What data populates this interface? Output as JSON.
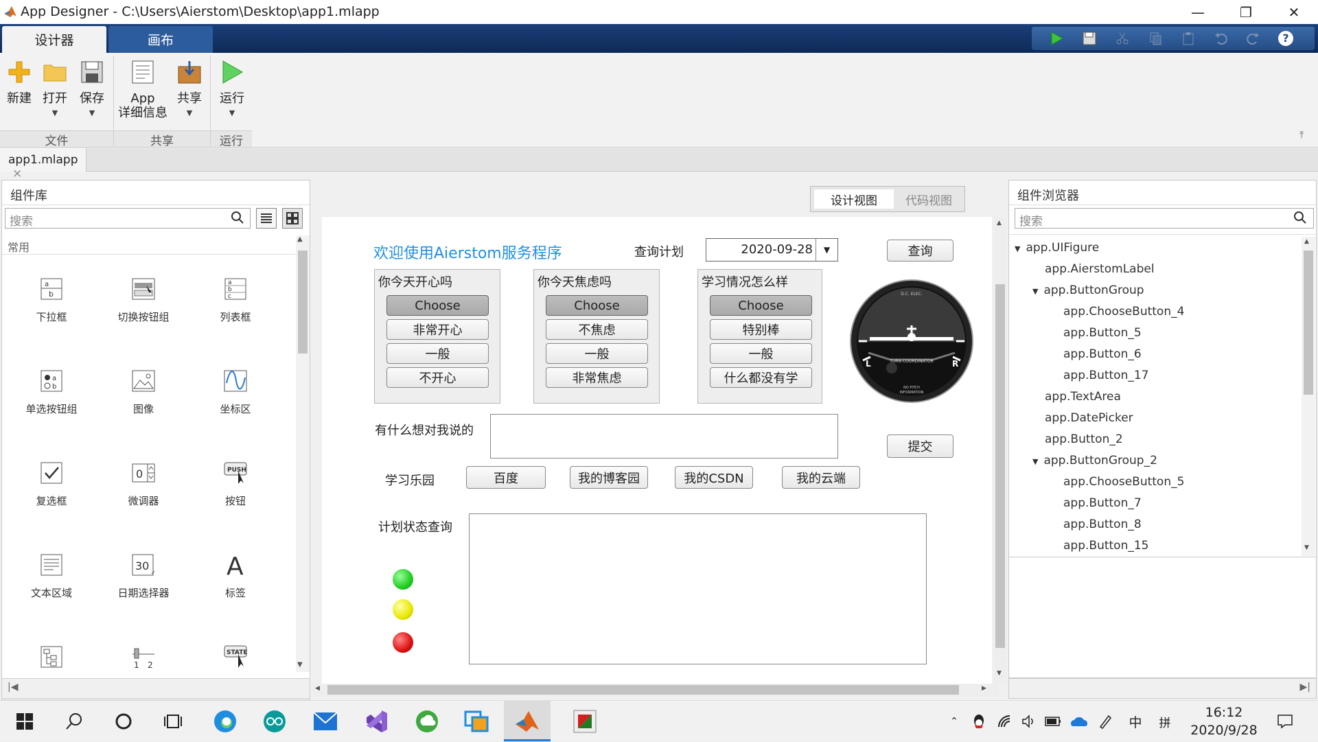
{
  "window": {
    "title": "App Designer - C:\\Users\\Aierstom\\Desktop\\app1.mlapp",
    "minimize": "—",
    "restore": "❐",
    "close": "✕"
  },
  "ribbon_tabs": [
    "设计器",
    "画布"
  ],
  "ribbon": {
    "new": "新建",
    "open": "打开",
    "save": "保存",
    "app_details_line1": "App",
    "app_details_line2": "详细信息",
    "share": "共享",
    "run": "运行",
    "group_file": "文件",
    "group_share": "共享",
    "group_run": "运行"
  },
  "doc_tab": {
    "name": "app1.mlapp",
    "close": "×"
  },
  "library": {
    "title": "组件库",
    "search_placeholder": "搜索",
    "section": "常用",
    "items": [
      "下拉框",
      "切换按钮组",
      "列表框",
      "单选按钮组",
      "图像",
      "坐标区",
      "复选框",
      "微调器",
      "按钮",
      "文本区域",
      "日期选择器",
      "标签"
    ]
  },
  "view_toggle": {
    "design": "设计视图",
    "code": "代码视图"
  },
  "app": {
    "welcome": "欢迎使用Aierstom服务程序",
    "query_plan_label": "查询计划",
    "date_value": "2020-09-28",
    "query_button": "查询",
    "group1": {
      "title": "你今天开心吗",
      "buttons": [
        "Choose",
        "非常开心",
        "一般",
        "不开心"
      ]
    },
    "group2": {
      "title": "你今天焦虑吗",
      "buttons": [
        "Choose",
        "不焦虑",
        "一般",
        "非常焦虑"
      ]
    },
    "group3": {
      "title": "学习情况怎么样",
      "buttons": [
        "Choose",
        "特别棒",
        "一般",
        "什么都没有学"
      ]
    },
    "say_label": "有什么想对我说的",
    "submit_button": "提交",
    "study_label": "学习乐园",
    "links": [
      "百度",
      "我的博客园",
      "我的CSDN",
      "我的云端"
    ],
    "status_label": "计划状态查询",
    "lamp_colors": [
      "#22cc22",
      "#e8e800",
      "#dd1111"
    ],
    "gauge": {
      "top": "D.C. ELEC.",
      "mid": "TURN COORDINATOR",
      "left": "L",
      "right": "R",
      "bottom_line1": "NO PITCH",
      "bottom_line2": "INFORMATION"
    }
  },
  "browser": {
    "title": "组件浏览器",
    "search_placeholder": "搜索",
    "tree": [
      "app.UIFigure",
      "app.AierstomLabel",
      "app.ButtonGroup",
      "app.ChooseButton_4",
      "app.Button_5",
      "app.Button_6",
      "app.Button_17",
      "app.TextArea",
      "app.DatePicker",
      "app.Button_2",
      "app.ButtonGroup_2",
      "app.ChooseButton_5",
      "app.Button_7",
      "app.Button_8",
      "app.Button_15"
    ]
  },
  "taskbar": {
    "time": "16:12",
    "date": "2020/9/28",
    "ime1": "中",
    "ime2": "拼"
  }
}
